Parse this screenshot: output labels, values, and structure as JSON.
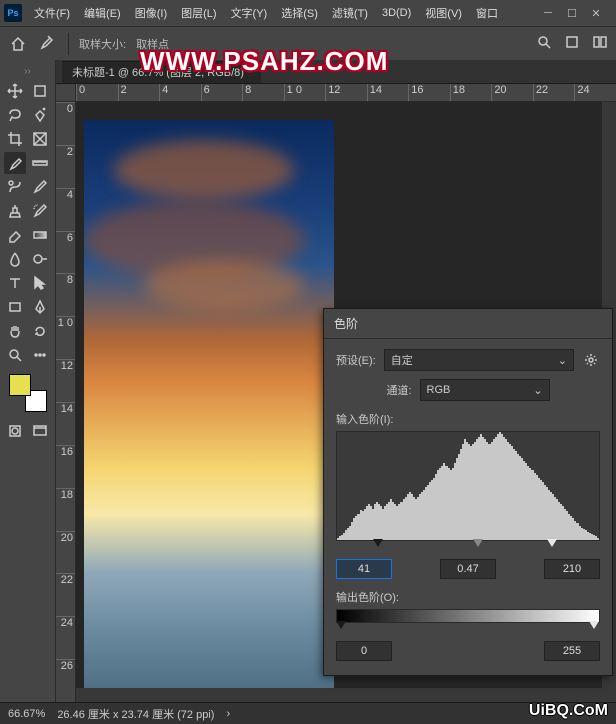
{
  "menubar": {
    "items": [
      "文件(F)",
      "编辑(E)",
      "图像(I)",
      "图层(L)",
      "文字(Y)",
      "选择(S)",
      "滤镜(T)",
      "3D(D)",
      "视图(V)",
      "窗口"
    ]
  },
  "options_bar": {
    "sample_size_label": "取样大小:",
    "sample_point_label": "取样点"
  },
  "document": {
    "tab_title": "未标题-1 @ 66.7% (图层 2, RGB/8) *",
    "zoom": "66.67%",
    "dimensions": "26.46 厘米 x 23.74 厘米 (72 ppi)"
  },
  "rulers": {
    "h": [
      "0",
      "2",
      "4",
      "6",
      "8",
      "1 0",
      "12",
      "14",
      "16",
      "18",
      "20",
      "22",
      "24"
    ],
    "v": [
      "0",
      "2",
      "4",
      "6",
      "8",
      "1 0",
      "12",
      "14",
      "16",
      "18",
      "20",
      "22",
      "24",
      "26"
    ]
  },
  "levels_dialog": {
    "title": "色阶",
    "preset_label": "预设(E):",
    "preset_value": "自定",
    "channel_label": "通道:",
    "channel_value": "RGB",
    "input_label": "输入色阶(I):",
    "output_label": "输出色阶(O):",
    "input_values": {
      "black": "41",
      "gamma": "0.47",
      "white": "210"
    },
    "output_values": {
      "black": "0",
      "white": "255"
    }
  },
  "watermarks": {
    "top": "WWW.PSAHZ.COM",
    "bottom": "UiBQ.CoM"
  },
  "tools": {
    "left": [
      "move",
      "marquee",
      "lasso",
      "magic-wand",
      "crop",
      "slice",
      "eyedropper",
      "ruler-tool",
      "healing-brush",
      "brush",
      "clone",
      "history-brush",
      "eraser",
      "gradient",
      "blur",
      "dodge",
      "pen",
      "type",
      "path-select",
      "rectangle",
      "hand",
      "zoom"
    ],
    "grid": [
      [
        "move",
        "artboard"
      ],
      [
        "lasso",
        "quick-select"
      ],
      [
        "crop",
        "frame"
      ],
      [
        "eyedropper",
        "ruler-tool"
      ],
      [
        "healing",
        "brush"
      ],
      [
        "clone",
        "history"
      ],
      [
        "eraser",
        "gradient"
      ],
      [
        "blur",
        "dodge"
      ],
      [
        "pen",
        "type"
      ],
      [
        "path",
        "shape"
      ],
      [
        "hand",
        "rotate"
      ],
      [
        "zoom",
        "more"
      ]
    ]
  },
  "chart_data": {
    "type": "bar",
    "title": "输入色阶(I)",
    "xlabel": "",
    "ylabel": "",
    "xrange": [
      0,
      255
    ],
    "values": [
      2,
      3,
      4,
      6,
      8,
      10,
      12,
      15,
      18,
      20,
      22,
      25,
      24,
      26,
      28,
      30,
      28,
      26,
      30,
      32,
      30,
      28,
      26,
      28,
      30,
      32,
      34,
      32,
      30,
      28,
      30,
      32,
      34,
      36,
      38,
      40,
      38,
      36,
      34,
      36,
      38,
      40,
      42,
      44,
      46,
      48,
      50,
      52,
      55,
      58,
      60,
      62,
      64,
      62,
      60,
      58,
      60,
      64,
      68,
      72,
      76,
      80,
      84,
      82,
      80,
      78,
      80,
      82,
      84,
      86,
      88,
      86,
      84,
      82,
      80,
      82,
      84,
      86,
      88,
      90,
      88,
      86,
      84,
      82,
      80,
      78,
      76,
      74,
      72,
      70,
      68,
      66,
      64,
      62,
      60,
      58,
      56,
      54,
      52,
      50,
      48,
      46,
      44,
      42,
      40,
      38,
      36,
      34,
      32,
      30,
      28,
      26,
      24,
      22,
      20,
      18,
      16,
      14,
      12,
      10,
      9,
      8,
      7,
      6,
      5,
      4,
      3,
      2
    ],
    "input_sliders": {
      "black": 41,
      "gamma": 0.47,
      "white": 210
    },
    "output_sliders": {
      "black": 0,
      "white": 255
    }
  }
}
